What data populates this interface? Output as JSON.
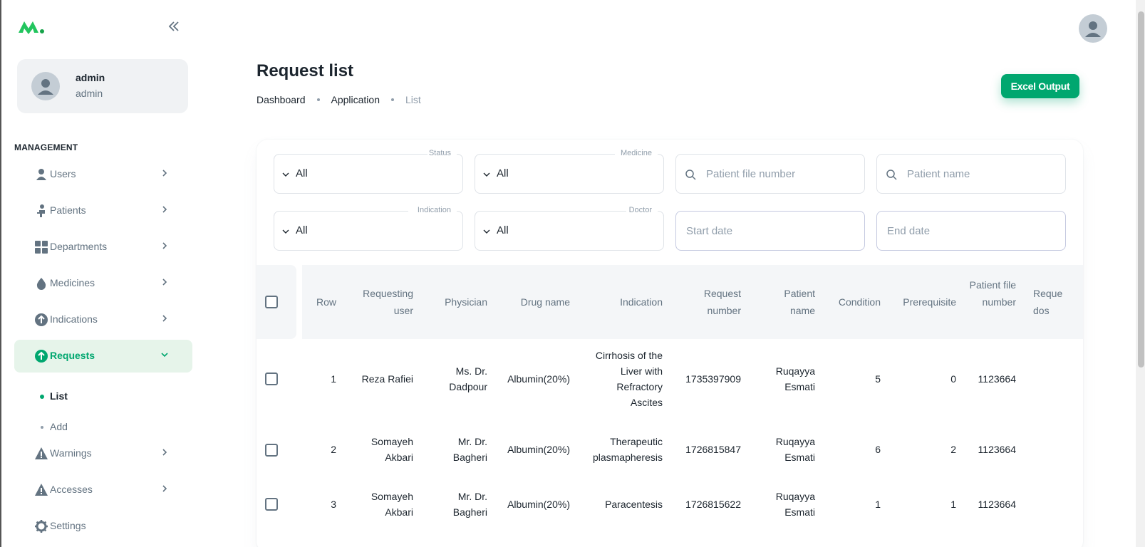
{
  "sidebar": {
    "account": {
      "name": "admin",
      "role": "admin"
    },
    "section_title": "MANAGEMENT",
    "items": [
      {
        "label": "Users",
        "icon": "user-icon"
      },
      {
        "label": "Patients",
        "icon": "patient-icon"
      },
      {
        "label": "Departments",
        "icon": "grid-icon"
      },
      {
        "label": "Medicines",
        "icon": "drop-icon"
      },
      {
        "label": "Indications",
        "icon": "arrow-up-circle-icon"
      },
      {
        "label": "Requests",
        "icon": "arrow-up-circle-icon",
        "active": true
      },
      {
        "label": "Warnings",
        "icon": "warning-icon"
      },
      {
        "label": "Accesses",
        "icon": "warning-icon"
      },
      {
        "label": "Settings",
        "icon": "gear-icon"
      }
    ],
    "sub_items": [
      {
        "label": "List",
        "active": true
      },
      {
        "label": "Add"
      }
    ]
  },
  "header": {
    "title": "Request list",
    "breadcrumb": [
      "Dashboard",
      "Application",
      "List"
    ],
    "excel_label": "Excel Output"
  },
  "filters": {
    "status": {
      "label": "Status",
      "value": "All"
    },
    "medicine": {
      "label": "Medicine",
      "value": "All"
    },
    "patient_file": {
      "placeholder": "Patient file number"
    },
    "patient_name": {
      "placeholder": "Patient name"
    },
    "indication": {
      "label": "Indication",
      "value": "All"
    },
    "doctor": {
      "label": "Doctor",
      "value": "All"
    },
    "start_date": {
      "placeholder": "Start date"
    },
    "end_date": {
      "placeholder": "End date"
    }
  },
  "table": {
    "headers": {
      "row": "Row",
      "requesting_user": "Requesting user",
      "physician": "Physician",
      "drug_name": "Drug name",
      "indication": "Indication",
      "request_number": "Request number",
      "patient_name": "Patient name",
      "condition": "Condition",
      "prerequisite": "Prerequisite",
      "patient_file_number": "Patient file number",
      "requested_dose": "Reque dos"
    },
    "rows": [
      {
        "row": "1",
        "requesting_user": "Reza Rafiei",
        "physician": "Ms. Dr. Dadpour",
        "drug_name": "Albumin(20%)",
        "indication": "Cirrhosis of the Liver with Refractory Ascites",
        "request_number": "1735397909",
        "patient_name": "Ruqayya Esmati",
        "condition": "5",
        "prerequisite": "0",
        "patient_file_number": "1123664"
      },
      {
        "row": "2",
        "requesting_user": "Somayeh Akbari",
        "physician": "Mr. Dr. Bagheri",
        "drug_name": "Albumin(20%)",
        "indication": "Therapeutic plasmapheresis",
        "request_number": "1726815847",
        "patient_name": "Ruqayya Esmati",
        "condition": "6",
        "prerequisite": "2",
        "patient_file_number": "1123664"
      },
      {
        "row": "3",
        "requesting_user": "Somayeh Akbari",
        "physician": "Mr. Dr. Bagheri",
        "drug_name": "Albumin(20%)",
        "indication": "Paracentesis",
        "request_number": "1726815622",
        "patient_name": "Ruqayya Esmati",
        "condition": "1",
        "prerequisite": "1",
        "patient_file_number": "1123664"
      }
    ]
  },
  "colors": {
    "accent": "#00a76f",
    "active_bg": "#e6f4ea",
    "muted": "#637381"
  }
}
